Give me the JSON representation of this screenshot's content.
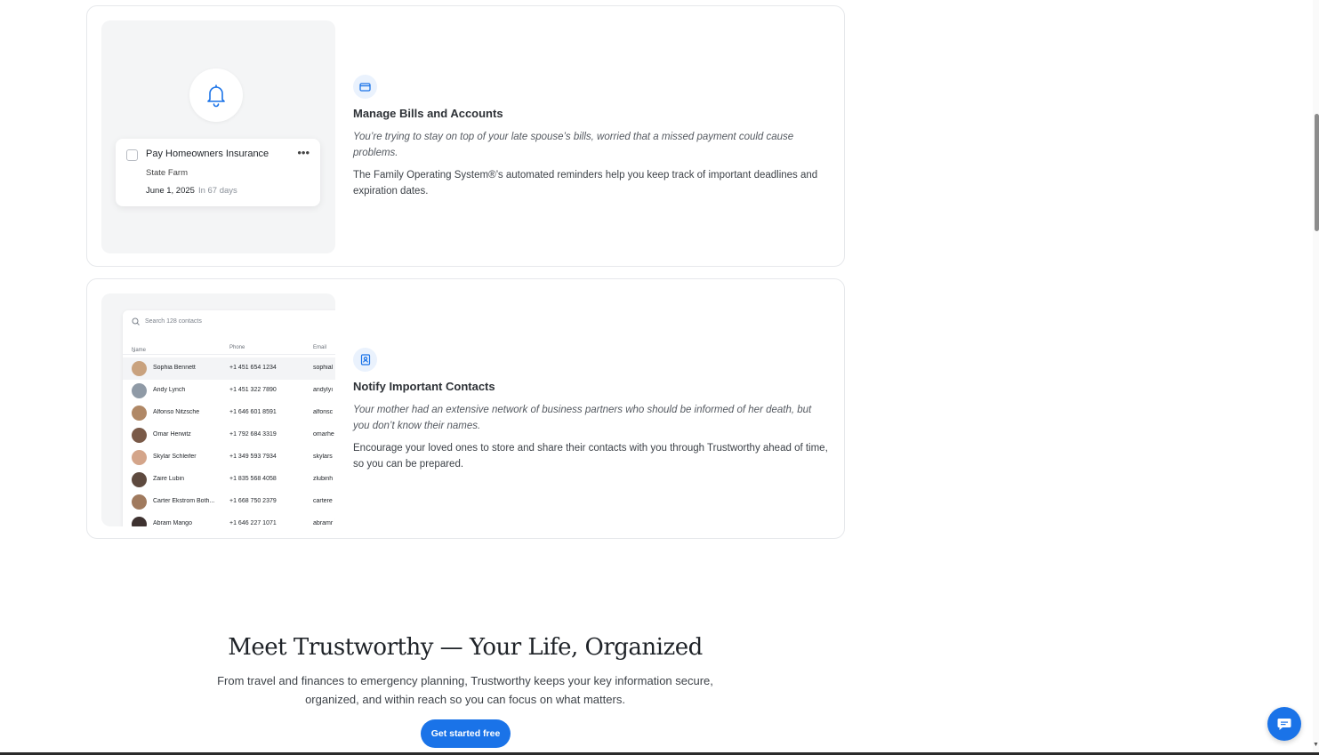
{
  "cards": [
    {
      "icon": "folder-icon",
      "title": "Manage Bills and Accounts",
      "quote": "You’re trying to stay on top of your late spouse’s bills, worried that a missed payment could cause problems.",
      "body": "The Family Operating System®’s automated reminders help you keep track of important deadlines and expiration dates.",
      "task": {
        "title": "Pay Homeowners Insurance",
        "company": "State Farm",
        "date": "June 1, 2025",
        "due": "In 67 days"
      }
    },
    {
      "icon": "contact-book-icon",
      "title": "Notify Important Contacts",
      "quote": "Your mother had an extensive network of business partners who should be informed of her death, but you don’t know their names.",
      "body": "Encourage your loved ones to store and share their contacts with you through Trustworthy ahead of time, so you can be prepared.",
      "contacts": {
        "search_placeholder": "Search 128 contacts",
        "columns": [
          "Name",
          "Phone",
          "Email"
        ],
        "rows": [
          {
            "name": "Sophia Bennett",
            "phone": "+1 451 654 1234",
            "email": "sophial"
          },
          {
            "name": "Andy Lynch",
            "phone": "+1 451 322 7890",
            "email": "andylyı"
          },
          {
            "name": "Alfonso Nitzsche",
            "phone": "+1 646 601 8591",
            "email": "alfonsc"
          },
          {
            "name": "Omar Herwitz",
            "phone": "+1 792 684 3319",
            "email": "omarhe"
          },
          {
            "name": "Skylar Schleifer",
            "phone": "+1 349 593 7934",
            "email": "skylars"
          },
          {
            "name": "Zaire Lubin",
            "phone": "+1 835 568 4058",
            "email": "zlubinh"
          },
          {
            "name": "Carter Ekstrom Both...",
            "phone": "+1 668 750 2379",
            "email": "cartere"
          },
          {
            "name": "Abram Mango",
            "phone": "+1 646 227 1071",
            "email": "abramr"
          }
        ]
      }
    }
  ],
  "hero": {
    "title": "Meet Trustworthy — Your Life, Organized",
    "subtitle": "From travel and finances to emergency planning, Trustworthy keeps your key information secure, organized, and within reach so you can focus on what matters.",
    "cta_label": "Get started free"
  },
  "colors": {
    "accent": "#1a73e8",
    "icon_bg": "#eaf2fd",
    "avatars": [
      "#c9a27e",
      "#8f9aa6",
      "#b08866",
      "#7a5a48",
      "#d4a58a",
      "#5e4a3f",
      "#a07a5e",
      "#3e3230"
    ]
  }
}
